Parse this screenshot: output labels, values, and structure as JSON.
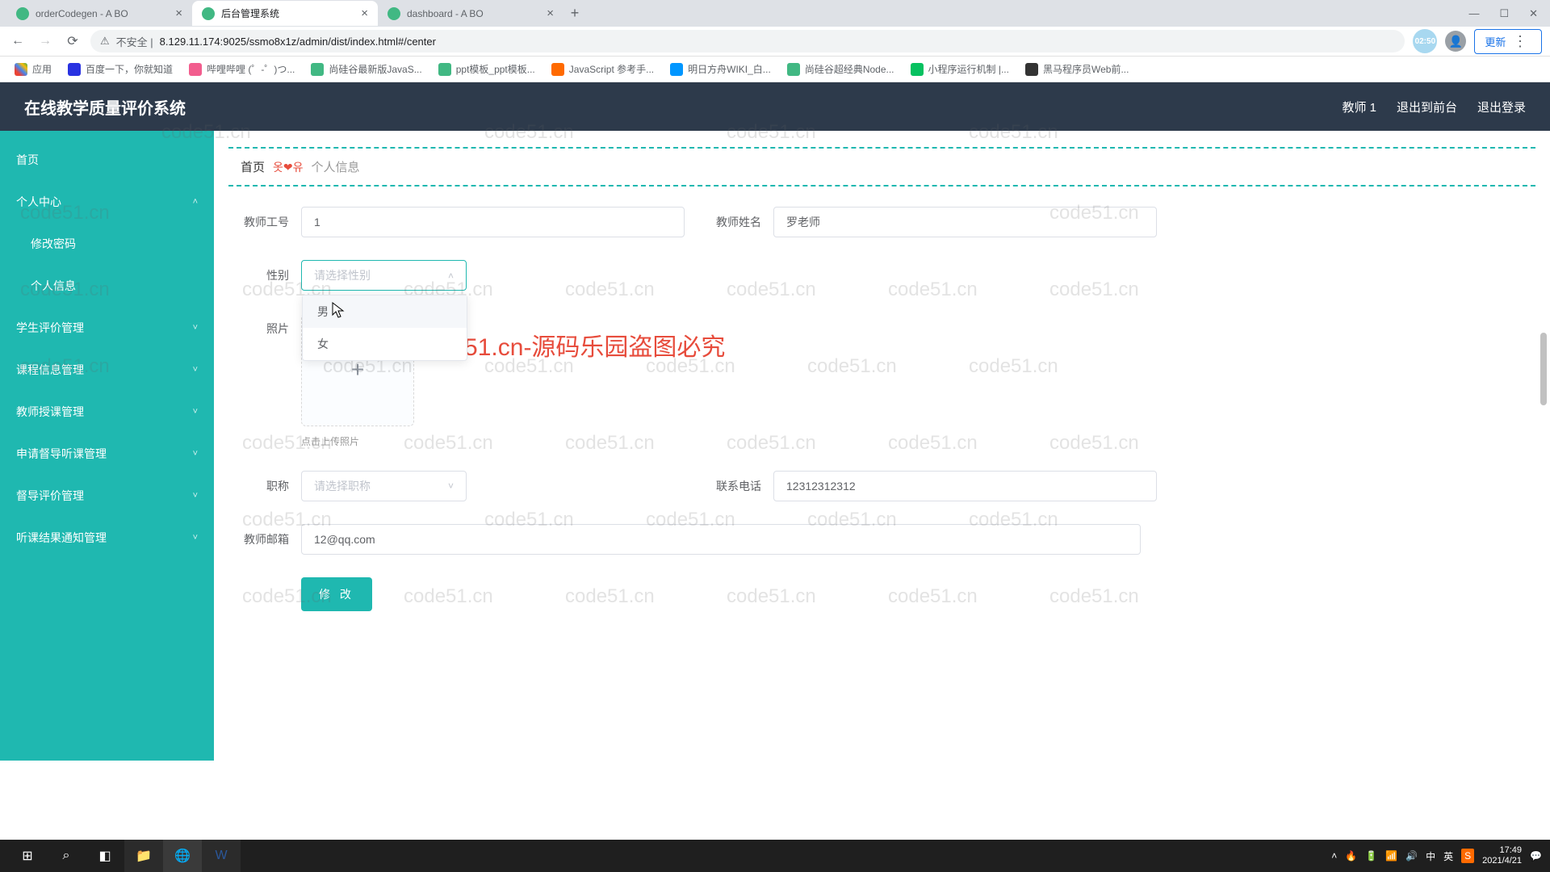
{
  "browser": {
    "tabs": [
      {
        "title": "orderCodegen - A BO"
      },
      {
        "title": "后台管理系统"
      },
      {
        "title": "dashboard - A BO"
      }
    ],
    "url_prefix": "不安全 |",
    "url": "8.129.11.174:9025/ssmo8x1z/admin/dist/index.html#/center",
    "time_badge": "02:50",
    "update_label": "更新",
    "bookmarks": [
      {
        "label": "应用"
      },
      {
        "label": "百度一下，你就知道"
      },
      {
        "label": "哔哩哔哩 (゜-゜)つ..."
      },
      {
        "label": "尚硅谷最新版JavaS..."
      },
      {
        "label": "ppt模板_ppt模板..."
      },
      {
        "label": "JavaScript 参考手..."
      },
      {
        "label": "明日方舟WIKI_白..."
      },
      {
        "label": "尚硅谷超经典Node..."
      },
      {
        "label": "小程序运行机制 |..."
      },
      {
        "label": "黑马程序员Web前..."
      }
    ]
  },
  "header": {
    "title": "在线教学质量评价系统",
    "user": "教师 1",
    "back_label": "退出到前台",
    "logout_label": "退出登录"
  },
  "sidebar": {
    "items": [
      {
        "label": "首页",
        "expandable": false
      },
      {
        "label": "个人中心",
        "expandable": true,
        "open": true
      },
      {
        "label": "修改密码",
        "sub": true
      },
      {
        "label": "个人信息",
        "sub": true
      },
      {
        "label": "学生评价管理",
        "expandable": true
      },
      {
        "label": "课程信息管理",
        "expandable": true
      },
      {
        "label": "教师授课管理",
        "expandable": true
      },
      {
        "label": "申请督导听课管理",
        "expandable": true
      },
      {
        "label": "督导评价管理",
        "expandable": true
      },
      {
        "label": "听课结果通知管理",
        "expandable": true
      }
    ]
  },
  "breadcrumb": {
    "home": "首页",
    "deco": "옷❤유",
    "current": "个人信息"
  },
  "form": {
    "teacher_id_label": "教师工号",
    "teacher_id_value": "1",
    "teacher_name_label": "教师姓名",
    "teacher_name_value": "罗老师",
    "gender_label": "性别",
    "gender_placeholder": "请选择性别",
    "gender_options": [
      "男",
      "女"
    ],
    "photo_label": "照片",
    "upload_hint": "点击上传照片",
    "title_label": "职称",
    "title_placeholder": "请选择职称",
    "phone_label": "联系电话",
    "phone_value": "12312312312",
    "email_label": "教师邮箱",
    "email_value": "12@qq.com",
    "submit_label": "修 改"
  },
  "watermark_text": "code51.cn",
  "watermark_red": "code51.cn-源码乐园盗图必究",
  "taskbar": {
    "ime1": "中",
    "ime2": "英",
    "time": "17:49",
    "date": "2021/4/21"
  }
}
